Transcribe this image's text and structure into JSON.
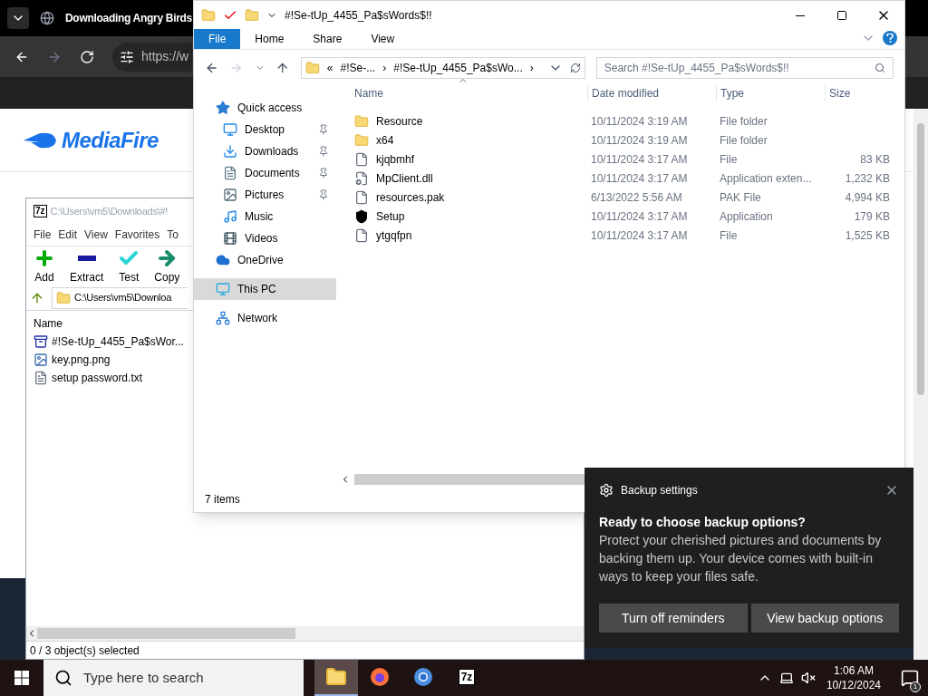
{
  "browser": {
    "tab_title": "Downloading Angry Birds",
    "url": "https://w",
    "logo": "MediaFire"
  },
  "archiver": {
    "title": "C:\\Users\\vm5\\Downloads\\#!",
    "app_icon": "7z",
    "menu": [
      "File",
      "Edit",
      "View",
      "Favorites",
      "To"
    ],
    "tools": [
      {
        "label": "Add",
        "kind": "add"
      },
      {
        "label": "Extract",
        "kind": "extract"
      },
      {
        "label": "Test",
        "kind": "test"
      },
      {
        "label": "Copy",
        "kind": "copy"
      }
    ],
    "path": "C:\\Users\\vm5\\Downloa",
    "column": "Name",
    "files": [
      {
        "name": "#!Se-tUp_4455_Pa$sWor...",
        "kind": "archive"
      },
      {
        "name": "key.png.png",
        "kind": "image"
      },
      {
        "name": "setup password.txt",
        "kind": "text"
      }
    ],
    "status": "0 / 3 object(s) selected"
  },
  "explorer": {
    "title": "#!Se-tUp_4455_Pa$sWords$!!",
    "tabs": [
      {
        "label": "File",
        "selected": true
      },
      {
        "label": "Home",
        "selected": false
      },
      {
        "label": "Share",
        "selected": false
      },
      {
        "label": "View",
        "selected": false
      }
    ],
    "breadcrumb": [
      "«",
      "#!Se-...",
      "›",
      "#!Se-tUp_4455_Pa$sWo...",
      "›"
    ],
    "search": {
      "placeholder": "Search #!Se-tUp_4455_Pa$sWords$!!"
    },
    "nav": [
      {
        "label": "Quick access",
        "kind": "star",
        "pinned": false,
        "selected": false,
        "children": [
          {
            "label": "Desktop",
            "kind": "desktop",
            "pinned": true,
            "selected": false
          },
          {
            "label": "Downloads",
            "kind": "download",
            "pinned": true,
            "selected": false
          },
          {
            "label": "Documents",
            "kind": "document",
            "pinned": true,
            "selected": false
          },
          {
            "label": "Pictures",
            "kind": "pictures",
            "pinned": true,
            "selected": false
          },
          {
            "label": "Music",
            "kind": "music",
            "pinned": false,
            "selected": false
          },
          {
            "label": "Videos",
            "kind": "videos",
            "pinned": false,
            "selected": false
          }
        ]
      },
      {
        "label": "OneDrive",
        "kind": "cloud",
        "pinned": false,
        "selected": false
      },
      {
        "label": "This PC",
        "kind": "pc",
        "pinned": false,
        "selected": true
      },
      {
        "label": "Network",
        "kind": "network",
        "pinned": false,
        "selected": false
      }
    ],
    "columns": [
      "Name",
      "Date modified",
      "Type",
      "Size"
    ],
    "rows": [
      {
        "name": "Resource",
        "date": "10/11/2024 3:19 AM",
        "type": "File folder",
        "kind": "folder"
      },
      {
        "name": "x64",
        "date": "10/11/2024 3:19 AM",
        "type": "File folder",
        "kind": "folder"
      },
      {
        "name": "kjqbmhf",
        "date": "10/11/2024 3:17 AM",
        "type": "File",
        "size": "83 KB",
        "kind": "file"
      },
      {
        "name": "MpClient.dll",
        "date": "10/11/2024 3:17 AM",
        "type": "Application exten...",
        "size": "1,232 KB",
        "kind": "dll"
      },
      {
        "name": "resources.pak",
        "date": "6/13/2022 5:56 AM",
        "type": "PAK File",
        "size": "4,994 KB",
        "kind": "file"
      },
      {
        "name": "Setup",
        "date": "10/11/2024 3:17 AM",
        "type": "Application",
        "size": "179 KB",
        "kind": "shield"
      },
      {
        "name": "ytgqfpn",
        "date": "10/11/2024 3:17 AM",
        "type": "File",
        "size": "1,525 KB",
        "kind": "file"
      }
    ],
    "status": "7 items"
  },
  "toast": {
    "app": "Backup settings",
    "heading": "Ready to choose backup options?",
    "body": "Protect your cherished pictures and documents by backing them up. Your device comes with built-in ways to keep your files safe.",
    "buttons": [
      "Turn off reminders",
      "View backup options"
    ]
  },
  "taskbar": {
    "search_placeholder": "Type here to search",
    "apps": [
      {
        "kind": "explorer",
        "selected": true
      },
      {
        "kind": "firefox",
        "selected": false
      },
      {
        "kind": "chrome",
        "selected": false
      },
      {
        "kind": "sevenzip",
        "selected": false,
        "label": "7z"
      }
    ],
    "time": "1:06 AM",
    "date": "10/12/2024",
    "notifications": "1"
  }
}
